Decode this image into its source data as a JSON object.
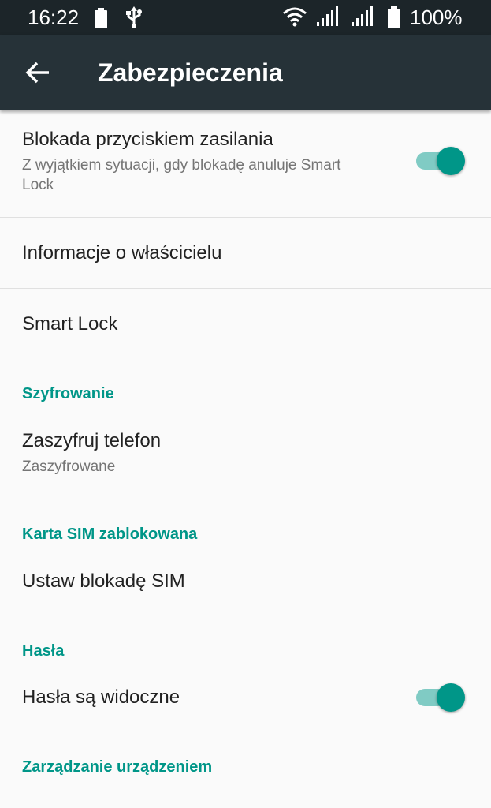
{
  "status_bar": {
    "time": "16:22",
    "battery_percent": "100%",
    "icons": [
      "battery-small-icon",
      "usb-icon",
      "wifi-icon",
      "signal-icon",
      "signal-icon",
      "battery-icon"
    ]
  },
  "app_bar": {
    "back_icon": "arrow-left-icon",
    "title": "Zabezpieczenia"
  },
  "settings": {
    "power_lock": {
      "title": "Blokada przyciskiem zasilania",
      "summary": "Z wyjątkiem sytuacji, gdy blokadę anuluje Smart Lock",
      "enabled": true
    },
    "owner_info": {
      "title": "Informacje o właścicielu"
    },
    "smart_lock": {
      "title": "Smart Lock"
    },
    "encryption_header": "Szyfrowanie",
    "encrypt_phone": {
      "title": "Zaszyfruj telefon",
      "summary": "Zaszyfrowane"
    },
    "sim_header": "Karta SIM zablokowana",
    "sim_lock": {
      "title": "Ustaw blokadę SIM"
    },
    "passwords_header": "Hasła",
    "show_passwords": {
      "title": "Hasła są widoczne",
      "enabled": true
    },
    "device_admin_header": "Zarządzanie urządzeniem"
  },
  "colors": {
    "status_bar": "#1c2529",
    "app_bar": "#263238",
    "accent": "#009688",
    "switch_track": "#80cbc4",
    "background": "#fafafa",
    "primary_text": "#212121",
    "secondary_text": "#757575"
  }
}
